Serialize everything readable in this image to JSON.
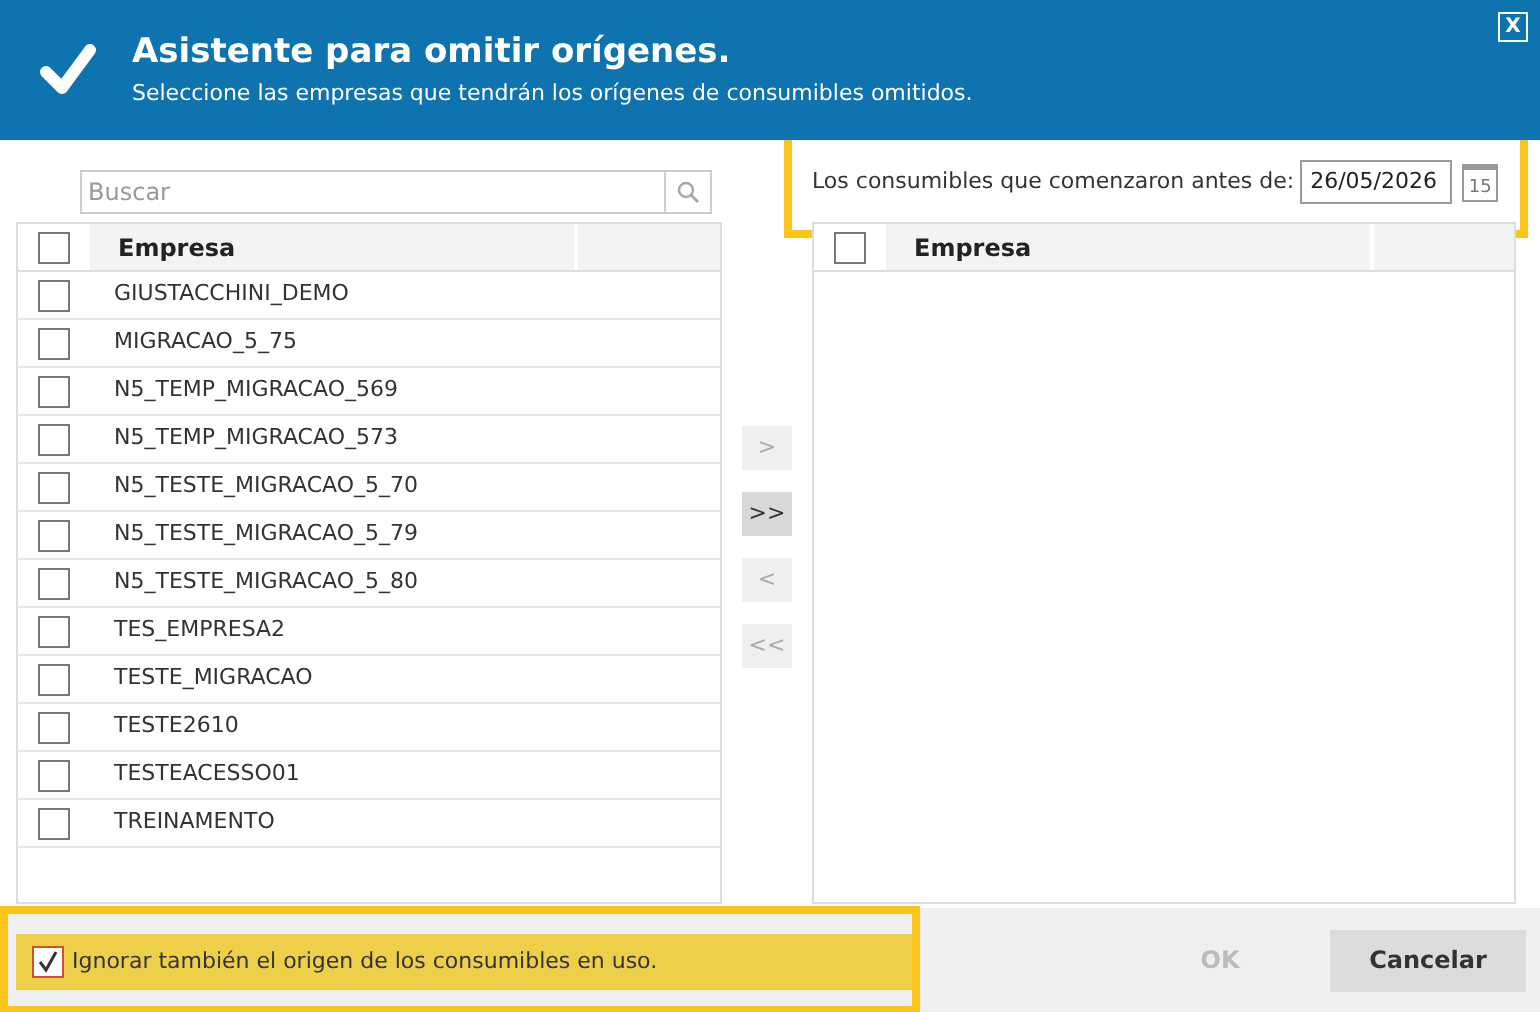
{
  "header": {
    "title": "Asistente para omitir orígenes.",
    "subtitle": "Seleccione las empresas que tendrán los orígenes de consumibles omitidos.",
    "close": "X"
  },
  "search": {
    "placeholder": "Buscar"
  },
  "date_filter": {
    "label": "Los consumibles que comenzaron antes de:",
    "value": "26/05/2026",
    "calendar_day": "15"
  },
  "left_table": {
    "header": "Empresa",
    "header_checked": false,
    "rows": [
      {
        "name": "GIUSTACCHINI_DEMO",
        "checked": false
      },
      {
        "name": "MIGRACAO_5_75",
        "checked": false
      },
      {
        "name": "N5_TEMP_MIGRACAO_569",
        "checked": false
      },
      {
        "name": "N5_TEMP_MIGRACAO_573",
        "checked": false
      },
      {
        "name": "N5_TESTE_MIGRACAO_5_70",
        "checked": false
      },
      {
        "name": "N5_TESTE_MIGRACAO_5_79",
        "checked": false
      },
      {
        "name": "N5_TESTE_MIGRACAO_5_80",
        "checked": false
      },
      {
        "name": "TES_EMPRESA2",
        "checked": false
      },
      {
        "name": "TESTE_MIGRACAO",
        "checked": false
      },
      {
        "name": "TESTE2610",
        "checked": false
      },
      {
        "name": "TESTEACESSO01",
        "checked": false
      },
      {
        "name": "TREINAMENTO",
        "checked": false
      }
    ]
  },
  "move_buttons": [
    {
      "label": ">",
      "disabled": true
    },
    {
      "label": ">>",
      "disabled": false
    },
    {
      "label": "<",
      "disabled": true
    },
    {
      "label": "<<",
      "disabled": true
    }
  ],
  "right_table": {
    "header": "Empresa",
    "header_checked": false
  },
  "ignore_in_use": {
    "label": "Ignorar también el origen de los consumibles en uso.",
    "checked": true
  },
  "buttons": [
    {
      "label": "OK",
      "disabled": true
    },
    {
      "label": "Cancelar",
      "disabled": false
    }
  ]
}
